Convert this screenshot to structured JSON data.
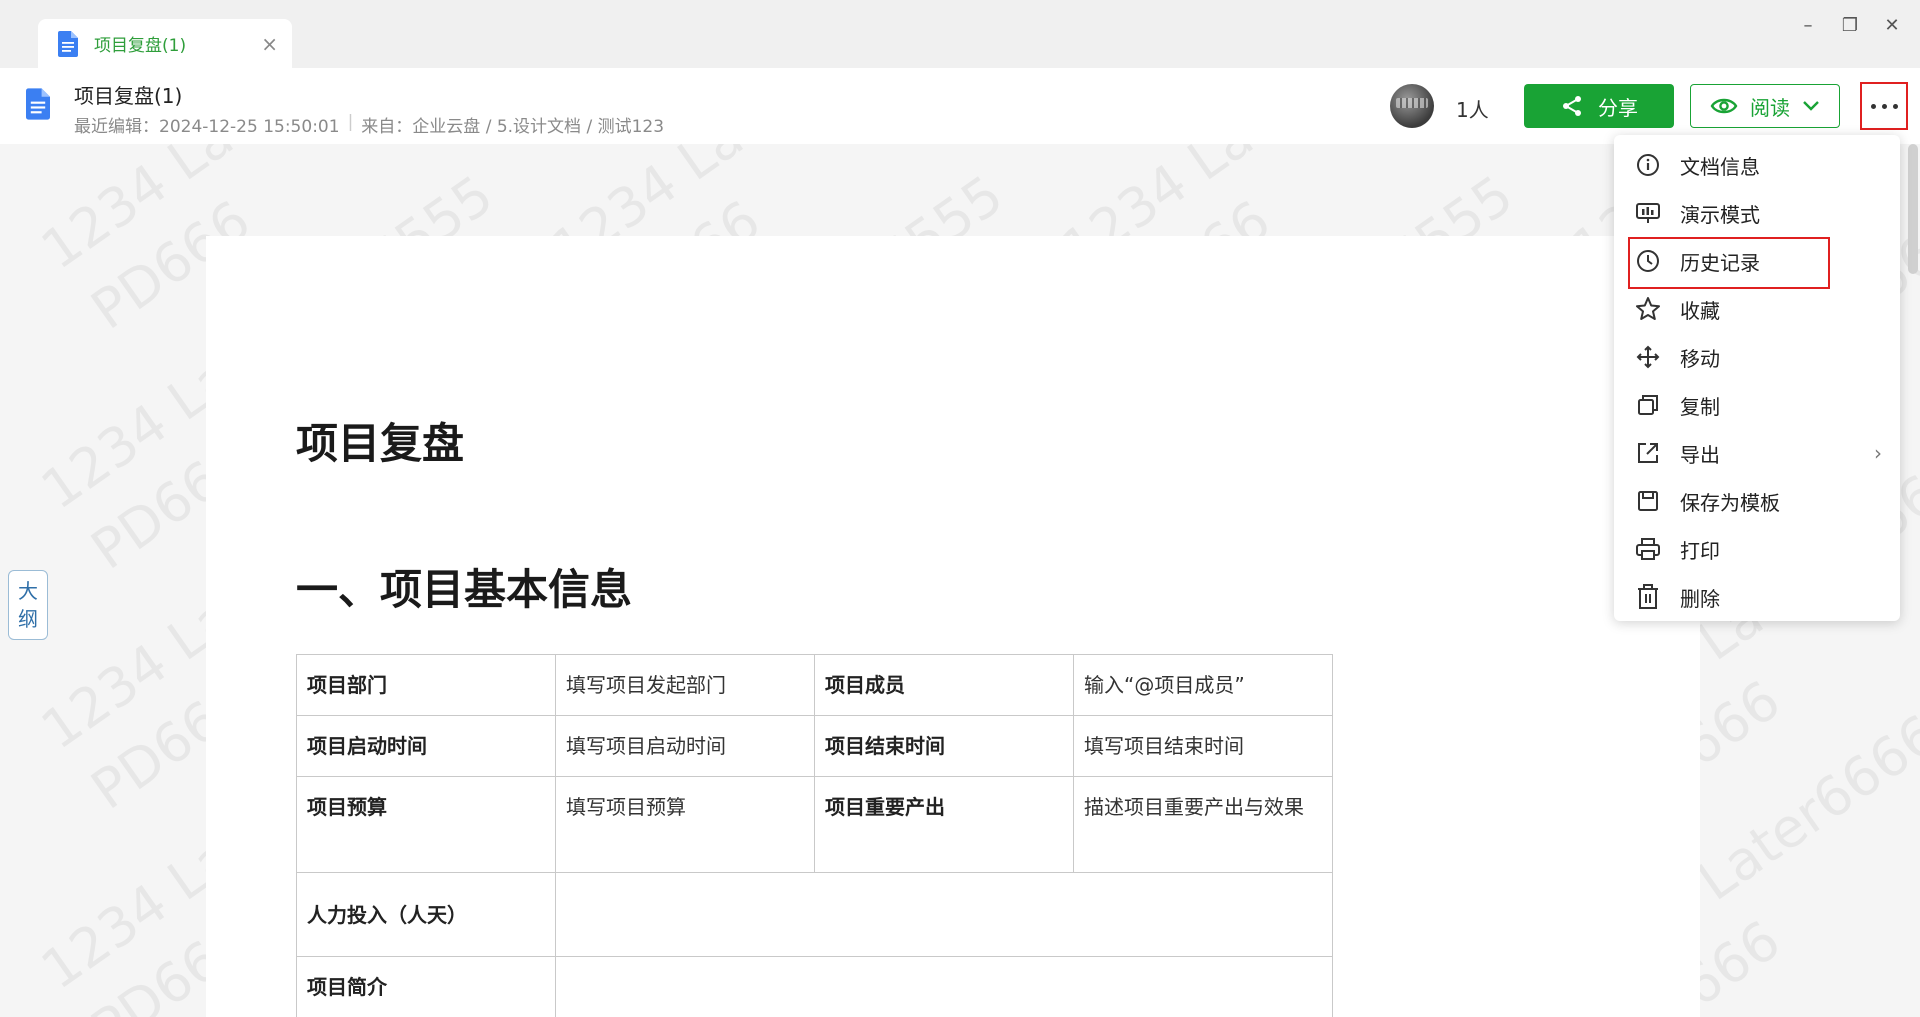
{
  "tab": {
    "title": "项目复盘(1)",
    "close_glyph": "×"
  },
  "window": {
    "minimize": "–",
    "restore": "❐",
    "close": "✕"
  },
  "header": {
    "title": "项目复盘(1)",
    "last_edit": "最近编辑：2024-12-25 15:50:01",
    "source": "来自：企业云盘 / 5.设计文档 / 测试123",
    "people_count": "1人",
    "share_label": "分享",
    "read_label": "阅读"
  },
  "outline": {
    "char1": "大",
    "char2": "纲"
  },
  "document": {
    "title": "项目复盘",
    "section1": "一、项目基本信息",
    "table": {
      "rows": [
        [
          "项目部门",
          "填写项目发起部门",
          "项目成员",
          "输入“@项目成员”"
        ],
        [
          "项目启动时间",
          "填写项目启动时间",
          "项目结束时间",
          "填写项目结束时间"
        ],
        [
          "项目预算",
          "填写项目预算",
          "项目重要产出",
          "描述项目重要产出与效果"
        ],
        [
          "人力投入（人天）",
          ""
        ],
        [
          "项目简介",
          ""
        ]
      ]
    }
  },
  "menu": {
    "items": [
      {
        "label": "文档信息",
        "icon": "info-icon"
      },
      {
        "label": "演示模式",
        "icon": "presentation-icon"
      },
      {
        "label": "历史记录",
        "icon": "clock-icon"
      },
      {
        "label": "收藏",
        "icon": "star-icon"
      },
      {
        "label": "移动",
        "icon": "move-icon"
      },
      {
        "label": "复制",
        "icon": "copy-icon"
      },
      {
        "label": "导出",
        "icon": "export-icon"
      },
      {
        "label": "保存为模板",
        "icon": "save-template-icon"
      },
      {
        "label": "打印",
        "icon": "printer-icon"
      },
      {
        "label": "删除",
        "icon": "trash-icon"
      }
    ]
  },
  "watermark": {
    "line1": "1234 Later6666555",
    "line2": "PD666"
  },
  "colors": {
    "brand_green": "#19a335",
    "highlight_red": "#e02020"
  }
}
